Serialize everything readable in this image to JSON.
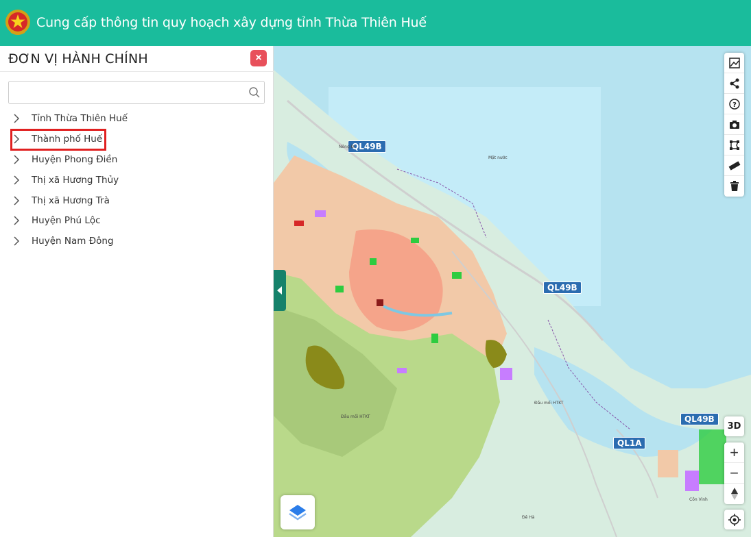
{
  "header": {
    "title": "Cung cấp thông tin quy hoạch xây dựng tỉnh Thừa Thiên Huế",
    "colors": {
      "bar": "#1abc9c",
      "text": "#ffffff"
    }
  },
  "sidebar": {
    "title": "ĐƠN VỊ HÀNH CHÍNH",
    "close_label": "×",
    "search": {
      "placeholder": "",
      "value": ""
    },
    "items": [
      {
        "label": "Tỉnh Thừa Thiên Huế"
      },
      {
        "label": "Thành phố Huế",
        "highlighted": true
      },
      {
        "label": "Huyện Phong Điền"
      },
      {
        "label": "Thị xã Hương Thủy"
      },
      {
        "label": "Thị xã Hương Trà"
      },
      {
        "label": "Huyện Phú Lộc"
      },
      {
        "label": "Huyện Nam Đông"
      }
    ]
  },
  "map": {
    "road_shields": [
      "QL49B",
      "QL49B",
      "QL49B",
      "QL1A"
    ],
    "place_labels": [
      "Nông Đi",
      "Mặt nước",
      "Đầu mối HTKT",
      "Đầu mối HTKT",
      "Cồn Vinh",
      "Đê Hà"
    ],
    "toolbar_icons": [
      "legend-icon",
      "share-icon",
      "help-icon",
      "camera-icon",
      "polygon-icon",
      "ruler-icon",
      "trash-icon"
    ],
    "btn_3d": "3D",
    "zoom_in": "+",
    "zoom_out": "−"
  }
}
